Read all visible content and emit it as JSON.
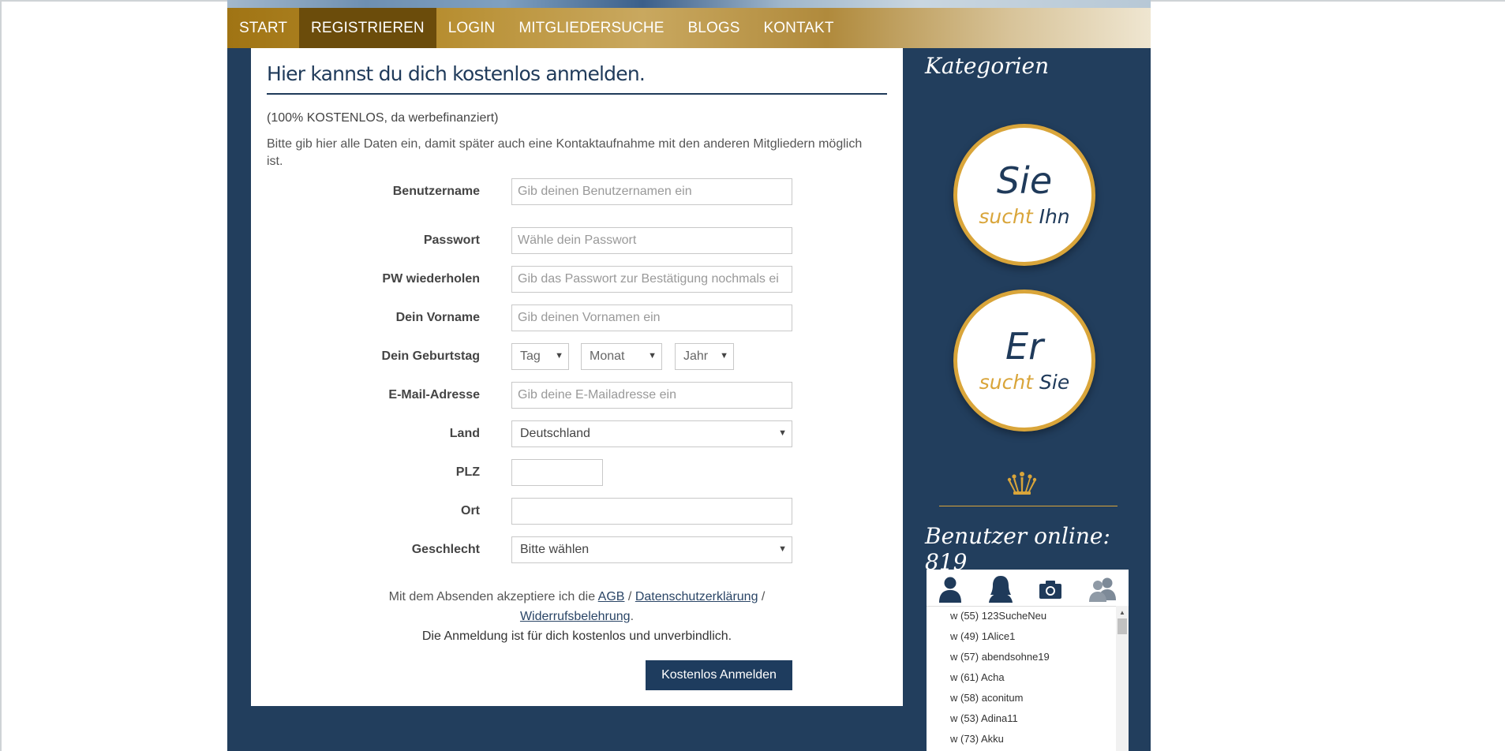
{
  "nav": {
    "items": [
      {
        "label": "START"
      },
      {
        "label": "REGISTRIEREN"
      },
      {
        "label": "LOGIN"
      },
      {
        "label": "MITGLIEDERSUCHE"
      },
      {
        "label": "BLOGS"
      },
      {
        "label": "KONTAKT"
      }
    ],
    "active": "REGISTRIEREN"
  },
  "form": {
    "title": "Hier kannst du dich kostenlos anmelden.",
    "note": "(100% KOSTENLOS, da werbefinanziert)",
    "intro": "Bitte gib hier alle Daten ein, damit später auch eine Kontaktaufnahme mit den anderen Mitgliedern möglich ist.",
    "username": {
      "label": "Benutzername",
      "placeholder": "Gib deinen Benutzernamen ein"
    },
    "password": {
      "label": "Passwort",
      "placeholder": "Wähle dein Passwort"
    },
    "password_repeat": {
      "label": "PW wiederholen",
      "placeholder": "Gib das Passwort zur Bestätigung nochmals ei"
    },
    "firstname": {
      "label": "Dein Vorname",
      "placeholder": "Gib deinen Vornamen ein"
    },
    "birthday": {
      "label": "Dein Geburtstag",
      "day": "Tag",
      "month": "Monat",
      "year": "Jahr"
    },
    "email": {
      "label": "E-Mail-Adresse",
      "placeholder": "Gib deine E-Mailadresse ein"
    },
    "country": {
      "label": "Land",
      "value": "Deutschland"
    },
    "zip": {
      "label": "PLZ",
      "value": ""
    },
    "city": {
      "label": "Ort",
      "value": ""
    },
    "gender": {
      "label": "Geschlecht",
      "value": "Bitte wählen"
    },
    "terms_prefix": "Mit dem Absenden akzeptiere ich die",
    "terms_agb": "AGB",
    "terms_sep1": "/",
    "terms_privacy": "Datenschutzerklärung",
    "terms_sep2": "/",
    "terms_withdrawal": "Widerrufsbelehrung",
    "terms_end": ".",
    "free_note": "Die Anmeldung ist für dich kostenlos und unverbindlich.",
    "submit": "Kostenlos Anmelden"
  },
  "sidebar": {
    "categories_title": "Kategorien",
    "cat1": {
      "big": "Sie",
      "sub_gold": "sucht",
      "sub_blue": "Ihn"
    },
    "cat2": {
      "big": "Er",
      "sub_gold": "sucht",
      "sub_blue": "Sie"
    },
    "online_title": "Benutzer online: 819",
    "tabs": [
      "male-icon",
      "female-icon",
      "camera-icon",
      "couple-icon"
    ],
    "online_users": [
      "w (55) 123SucheNeu",
      "w (49) 1Alice1",
      "w (57) abendsohne19",
      "w (61) Acha",
      "w (58) aconitum",
      "w (53) Adina11",
      "w (73) Akku"
    ]
  },
  "colors": {
    "navy": "#223e5d",
    "gold": "#d9a53a",
    "nav_active": "#6b4c0b"
  }
}
